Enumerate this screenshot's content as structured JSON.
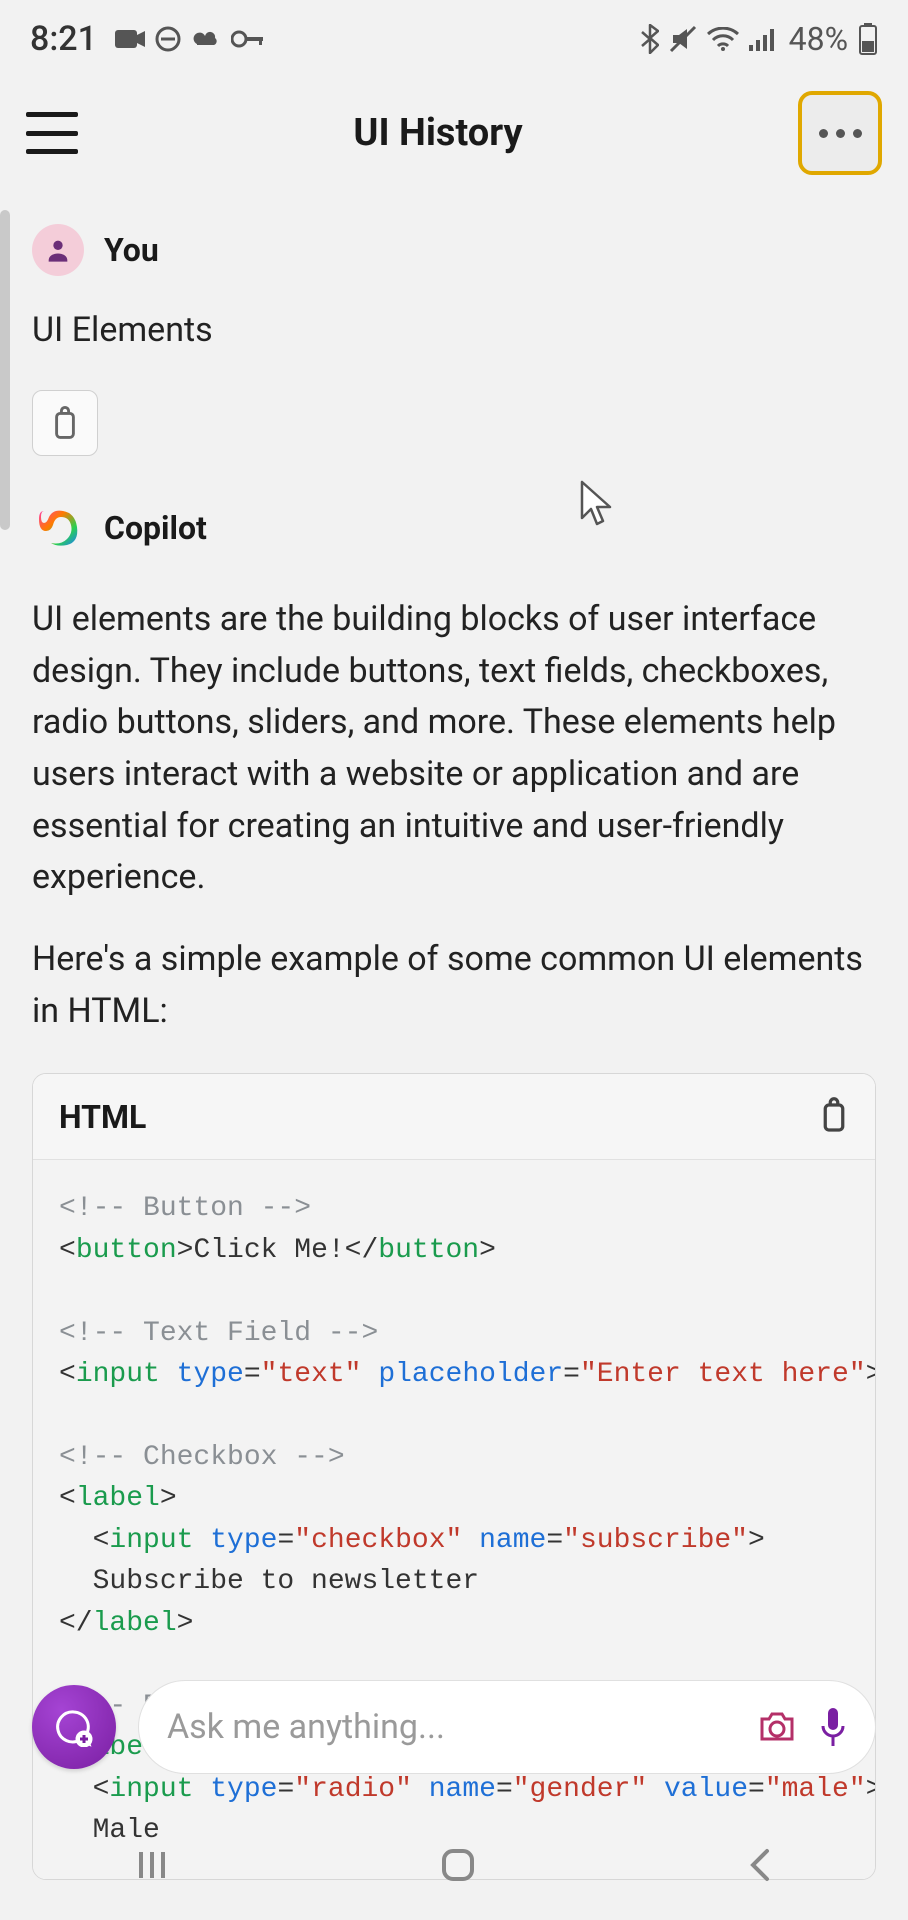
{
  "status": {
    "time": "8:21",
    "icons_left": [
      "camera-icon",
      "no-entry-icon",
      "sync-icon",
      "key-icon"
    ],
    "icons_right": [
      "bluetooth-icon",
      "mute-icon",
      "wifi-icon",
      "signal-icon"
    ],
    "battery_percent": "48%"
  },
  "header": {
    "title": "UI History"
  },
  "chat": {
    "user_sender": "You",
    "user_message": "UI Elements",
    "copilot_sender": "Copilot",
    "copilot_para1": "UI elements are the building blocks of user interface design. They include buttons, text fields, checkboxes, radio buttons, sliders, and more. These elements help users interact with a website or application and are essential for creating an intuitive and user-friendly experience.",
    "copilot_para2": "Here's a simple example of some common UI elements in HTML:"
  },
  "code": {
    "language": "HTML",
    "lines": [
      {
        "kind": "comment",
        "text": "<!-- Button -->"
      },
      {
        "kind": "tagpair",
        "open": "button",
        "text": "Click Me!",
        "close": "button"
      },
      {
        "kind": "blank"
      },
      {
        "kind": "comment",
        "text": "<!-- Text Field -->"
      },
      {
        "kind": "selfclose",
        "tag": "input",
        "attrs": [
          [
            "type",
            "\"text\""
          ],
          [
            "placeholder",
            "\"Enter text here\""
          ]
        ]
      },
      {
        "kind": "blank"
      },
      {
        "kind": "comment",
        "text": "<!-- Checkbox -->"
      },
      {
        "kind": "open",
        "tag": "label"
      },
      {
        "kind": "selfclose",
        "indent": 1,
        "tag": "input",
        "attrs": [
          [
            "type",
            "\"checkbox\""
          ],
          [
            "name",
            "\"subscribe\""
          ]
        ]
      },
      {
        "kind": "text",
        "indent": 1,
        "text": "Subscribe to newsletter"
      },
      {
        "kind": "close",
        "tag": "label"
      },
      {
        "kind": "blank"
      },
      {
        "kind": "comment",
        "text": "<!-- Radio Button -->"
      },
      {
        "kind": "open",
        "tag": "label"
      },
      {
        "kind": "selfclose",
        "indent": 1,
        "tag": "input",
        "attrs": [
          [
            "type",
            "\"radio\""
          ],
          [
            "name",
            "\"gender\""
          ],
          [
            "value",
            "\"male\""
          ]
        ]
      },
      {
        "kind": "text",
        "indent": 1,
        "text": "Male"
      }
    ]
  },
  "input": {
    "placeholder": "Ask me anything..."
  }
}
